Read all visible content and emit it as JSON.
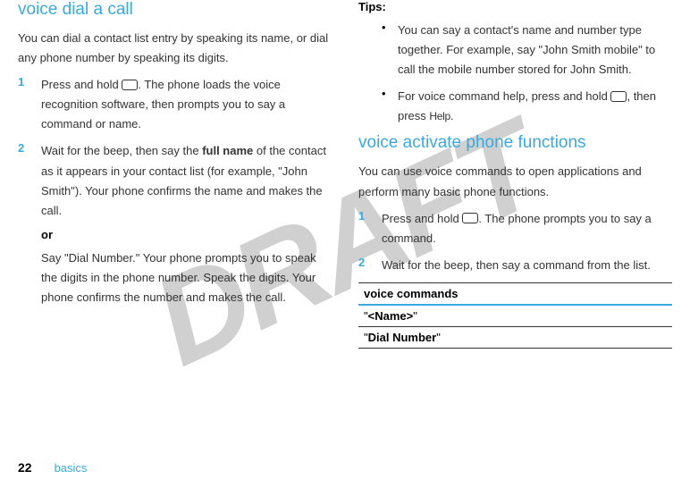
{
  "watermark": "DRAFT",
  "left": {
    "heading": "voice dial a call",
    "intro": "You can dial a contact list entry by speaking its name, or dial any phone number by speaking its digits.",
    "step1_num": "1",
    "step1_a": "Press and hold ",
    "step1_b": ". The phone loads the voice recognition software, then prompts you to say a command or name.",
    "step2_num": "2",
    "step2_a": "Wait for the beep, then say the ",
    "step2_bold": "full name",
    "step2_b": " of the contact as it appears in your contact list (for example, \"John Smith\"). Your phone confirms the name and makes the call.",
    "or": "or",
    "or_text": "Say \"Dial Number.\" Your phone prompts you to speak the digits in the phone number. Speak the digits. Your phone confirms the number and makes the call."
  },
  "right": {
    "tips_label": "Tips:",
    "bullet1": "You can say a contact's name and number type together. For example, say \"John Smith mobile\" to call the mobile number stored for John Smith.",
    "bullet2_a": "For voice command help, press and hold ",
    "bullet2_b": ", then press ",
    "bullet2_help": "Help",
    "bullet2_c": ".",
    "heading": "voice activate phone functions",
    "intro": "You can use voice commands to open applications and perform many basic phone functions.",
    "step1_num": "1",
    "step1_a": "Press and hold ",
    "step1_b": ". The phone prompts you to say a command.",
    "step2_num": "2",
    "step2_text": "Wait for the beep, then say a command from the list.",
    "table_header": "voice commands",
    "row1_a": "\"",
    "row1_b": "<Name>",
    "row1_c": "\"",
    "row2_a": "\"",
    "row2_b": "Dial Number",
    "row2_c": "\""
  },
  "footer": {
    "page": "22",
    "section": "basics"
  }
}
